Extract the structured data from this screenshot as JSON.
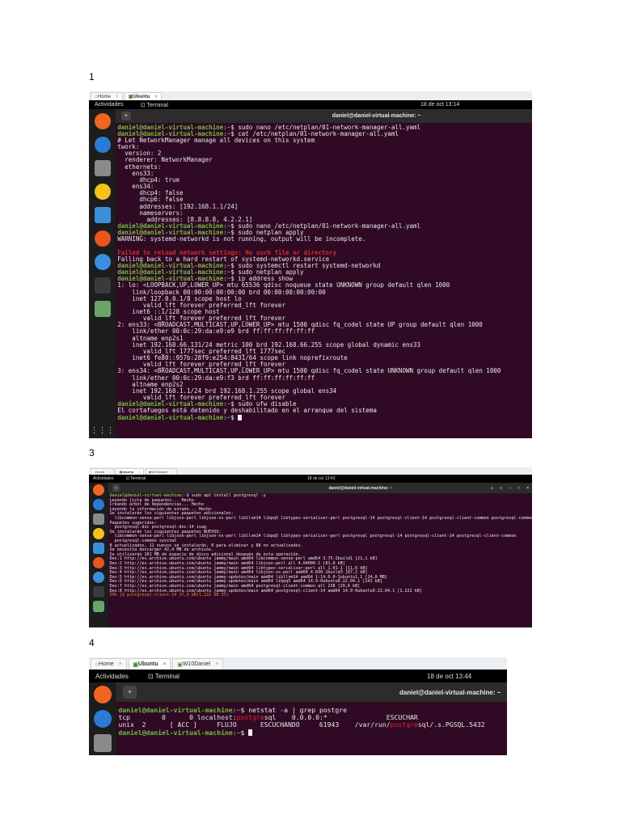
{
  "sections": [
    {
      "number": "1",
      "tabs": [
        {
          "label": "Home",
          "active": false
        },
        {
          "label": "Ubuntu",
          "active": true
        }
      ],
      "activities": "Actividades",
      "app": "Terminal",
      "clock": "18 de oct  13:14",
      "window_title": "daniel@daniel-virtual-machine: ~",
      "lines": [
        [
          [
            "prompt",
            "daniel@daniel-virtual-machine:"
          ],
          [
            "path",
            "~"
          ],
          [
            "",
            "$ sudo nano /etc/netplan/01-network-manager-all.yaml"
          ]
        ],
        [
          [
            "prompt",
            "daniel@daniel-virtual-machine:"
          ],
          [
            "path",
            "~"
          ],
          [
            "",
            "$ cat /etc/netplan/01-network-manager-all.yaml"
          ]
        ],
        [
          [
            "",
            "# Let NetworkManager manage all devices on this system"
          ]
        ],
        [
          [
            "",
            "twork:"
          ]
        ],
        [
          [
            "",
            "  version: 2"
          ]
        ],
        [
          [
            "",
            "  renderer: NetworkManager"
          ]
        ],
        [
          [
            "",
            "  ethernets:"
          ]
        ],
        [
          [
            "",
            "    ens33:"
          ]
        ],
        [
          [
            "",
            "      dhcp4: true"
          ]
        ],
        [
          [
            "",
            "    ens34:"
          ]
        ],
        [
          [
            "",
            "      dhcp4: false"
          ]
        ],
        [
          [
            "",
            "      dhcp6: false"
          ]
        ],
        [
          [
            "",
            "      addresses: [192.168.1.1/24]"
          ]
        ],
        [
          [
            "",
            "      nameservers:"
          ]
        ],
        [
          [
            "",
            "        addresses: [8.8.8.8, 4.2.2.1]"
          ]
        ],
        [
          [
            "prompt",
            "daniel@daniel-virtual-machine:"
          ],
          [
            "path",
            "~"
          ],
          [
            "",
            "$ sudo nano /etc/netplan/01-network-manager-all.yaml"
          ]
        ],
        [
          [
            "prompt",
            "daniel@daniel-virtual-machine:"
          ],
          [
            "path",
            "~"
          ],
          [
            "",
            "$ sudo netplan apply"
          ]
        ],
        [
          [
            "",
            "WARNING: systemd-networkd is not running, output will be incomplete."
          ]
        ],
        [
          [
            "",
            ""
          ]
        ],
        [
          [
            "err",
            "Failed to reload network settings: No such file or directory"
          ]
        ],
        [
          [
            "",
            "Falling back to a hard restart of systemd-networkd.service"
          ]
        ],
        [
          [
            "prompt",
            "daniel@daniel-virtual-machine:"
          ],
          [
            "path",
            "~"
          ],
          [
            "",
            "$ sudo systemctl restart systemd-networkd"
          ]
        ],
        [
          [
            "prompt",
            "daniel@daniel-virtual-machine:"
          ],
          [
            "path",
            "~"
          ],
          [
            "",
            "$ sudo netplan apply"
          ]
        ],
        [
          [
            "prompt",
            "daniel@daniel-virtual-machine:"
          ],
          [
            "path",
            "~"
          ],
          [
            "",
            "$ ip address show"
          ]
        ],
        [
          [
            "",
            "1: lo: <LOOPBACK,UP,LOWER_UP> mtu 65536 qdisc noqueue state UNKNOWN group default qlen 1000"
          ]
        ],
        [
          [
            "",
            "    link/loopback 00:00:00:00:00:00 brd 00:00:00:00:00:00"
          ]
        ],
        [
          [
            "",
            "    inet 127.0.0.1/8 scope host lo"
          ]
        ],
        [
          [
            "",
            "       valid_lft forever preferred_lft forever"
          ]
        ],
        [
          [
            "",
            "    inet6 ::1/128 scope host"
          ]
        ],
        [
          [
            "",
            "       valid_lft forever preferred_lft forever"
          ]
        ],
        [
          [
            "",
            "2: ens33: <BROADCAST,MULTICAST,UP,LOWER_UP> mtu 1500 qdisc fq_codel state UP group default qlen 1000"
          ]
        ],
        [
          [
            "",
            "    link/ether 00:0c:29:da:e9:e9 brd ff:ff:ff:ff:ff:ff"
          ]
        ],
        [
          [
            "",
            "    altname enp2s1"
          ]
        ],
        [
          [
            "",
            "    inet 192.168.66.131/24 metric 100 brd 192.168.66.255 scope global dynamic ens33"
          ]
        ],
        [
          [
            "",
            "       valid_lft 1777sec preferred_lft 1777sec"
          ]
        ],
        [
          [
            "",
            "    inet6 fe80::957b:28f9:e254:8431/64 scope link noprefixroute"
          ]
        ],
        [
          [
            "",
            "       valid_lft forever preferred_lft forever"
          ]
        ],
        [
          [
            "",
            "3: ens34: <BROADCAST,MULTICAST,UP,LOWER_UP> mtu 1500 qdisc fq_codel state UNKNOWN group default qlen 1000"
          ]
        ],
        [
          [
            "",
            "    link/ether 00:0c:29:da:e9:f3 brd ff:ff:ff:ff:ff:ff"
          ]
        ],
        [
          [
            "",
            "    altname enp2s2"
          ]
        ],
        [
          [
            "",
            "    inet 192.168.1.1/24 brd 192.168.1.255 scope global ens34"
          ]
        ],
        [
          [
            "",
            "       valid_lft forever preferred_lft forever"
          ]
        ],
        [
          [
            "prompt",
            "daniel@daniel-virtual-machine:"
          ],
          [
            "path",
            "~"
          ],
          [
            "",
            "$ sudo ufw disable"
          ]
        ],
        [
          [
            "",
            "El cortafuegos está detenido y deshabilitado en el arranque del sistema"
          ]
        ],
        [
          [
            "prompt",
            "daniel@daniel-virtual-machine:"
          ],
          [
            "path",
            "~"
          ],
          [
            "",
            "$ "
          ],
          [
            "cursor",
            " "
          ]
        ]
      ]
    },
    {
      "number": "3",
      "tabs": [
        {
          "label": "Home",
          "active": false
        },
        {
          "label": "Ubuntu",
          "active": true
        },
        {
          "label": "W10Daniel",
          "active": false
        }
      ],
      "activities": "Actividades",
      "app": "Terminal",
      "clock": "18 de oct  13:43",
      "window_title": "daniel@daniel-virtual-machine: ~",
      "lines": [
        [
          [
            "prompt",
            "daniel@daniel-virtual-machine:"
          ],
          [
            "path",
            "~"
          ],
          [
            "",
            "$ sudo apt install postgresql -y"
          ]
        ],
        [
          [
            "",
            "Leyendo lista de paquetes... Hecho"
          ]
        ],
        [
          [
            "",
            "Creando árbol de dependencias... Hecho"
          ]
        ],
        [
          [
            "",
            "Leyendo la información de estado... Hecho"
          ]
        ],
        [
          [
            "",
            "Se instalarán los siguientes paquetes adicionales:"
          ]
        ],
        [
          [
            "",
            "  libcommon-sense-perl libjson-perl libjson-xs-perl libllvm14 libpq5 libtypes-serialiser-perl postgresql-14 postgresql-client-14 postgresql-client-common postgresql-common sysstat"
          ]
        ],
        [
          [
            "",
            "Paquetes sugeridos:"
          ]
        ],
        [
          [
            "",
            "  postgresql-doc postgresql-doc-14 isag"
          ]
        ],
        [
          [
            "",
            "Se instalarán los siguientes paquetes NUEVOS:"
          ]
        ],
        [
          [
            "",
            "  libcommon-sense-perl libjson-perl libjson-xs-perl libllvm14 libpq5 libtypes-serialiser-perl postgresql postgresql-14 postgresql-client-14 postgresql-client-common"
          ]
        ],
        [
          [
            "",
            "  postgresql-common sysstat"
          ]
        ],
        [
          [
            "",
            "0 actualizados, 12 nuevos se instalarán, 0 para eliminar y 88 no actualizados."
          ]
        ],
        [
          [
            "",
            "Se necesita descargar 42,4 MB de archivos."
          ]
        ],
        [
          [
            "",
            "Se utilizarán 161 MB de espacio de disco adicional después de esta operación."
          ]
        ],
        [
          [
            "",
            "Des:1 http://es.archive.ubuntu.com/ubuntu jammy/main amd64 libcommon-sense-perl amd64 3.75-2build1 [21,1 kB]"
          ]
        ],
        [
          [
            "",
            "Des:2 http://es.archive.ubuntu.com/ubuntu jammy/main amd64 libjson-perl all 4.04000-1 [81,0 kB]"
          ]
        ],
        [
          [
            "",
            "Des:3 http://es.archive.ubuntu.com/ubuntu jammy/main amd64 libtypes-serialiser-perl all 1.01-1 [11,6 kB]"
          ]
        ],
        [
          [
            "",
            "Des:4 http://es.archive.ubuntu.com/ubuntu jammy/main amd64 libjson-xs-perl amd64 4.030-1build3 [87,2 kB]"
          ]
        ],
        [
          [
            "",
            "Des:5 http://es.archive.ubuntu.com/ubuntu jammy-updates/main amd64 libllvm14 amd64 1:14.0.0-1ubuntu1.1 [24,0 MB]"
          ]
        ],
        [
          [
            "",
            "Des:6 http://es.archive.ubuntu.com/ubuntu jammy-updates/main amd64 libpq5 amd64 14.9-0ubuntu0.22.04.1 [141 kB]"
          ]
        ],
        [
          [
            "",
            "Des:7 http://es.archive.ubuntu.com/ubuntu jammy/main amd64 postgresql-client-common all 238 [29,6 kB]"
          ]
        ],
        [
          [
            "",
            "Des:8 http://es.archive.ubuntu.com/ubuntu jammy-updates/main amd64 postgresql-client-14 amd64 14.9-0ubuntu0.22.04.1 [1.222 kB]"
          ]
        ],
        [
          [
            "dim",
            "59% [8 postgresql-client-14 37,0 kB/1.222 kB 3%]"
          ]
        ]
      ]
    },
    {
      "number": "4",
      "tabs": [
        {
          "label": "Home",
          "active": false
        },
        {
          "label": "Ubuntu",
          "active": true
        },
        {
          "label": "W10Daniel",
          "active": false
        }
      ],
      "activities": "Actividades",
      "app": "Terminal",
      "clock": "18 de oct  13:44",
      "window_title": "daniel@daniel-virtual-machine: ~",
      "lines": [
        [
          [
            "prompt",
            "daniel@daniel-virtual-machine:"
          ],
          [
            "path",
            "~"
          ],
          [
            "",
            "$ netstat -a | grep postgre"
          ]
        ],
        [
          [
            "",
            "tcp        0      0 localhost:"
          ],
          [
            "red",
            "postgre"
          ],
          [
            "",
            "sql    0.0.0.0:*               ESCUCHAR"
          ]
        ],
        [
          [
            "",
            "unix  2      [ ACC ]     FLUJO      ESCUCHANDO     61943    /var/run/"
          ],
          [
            "red",
            "postgre"
          ],
          [
            "",
            "sql/.s.PGSQL.5432"
          ]
        ],
        [
          [
            "prompt",
            "daniel@daniel-virtual-machine:"
          ],
          [
            "path",
            "~"
          ],
          [
            "",
            "$ "
          ],
          [
            "cursor",
            " "
          ]
        ]
      ]
    }
  ],
  "dock_icons": [
    "firefox-icon",
    "thunderbird-icon",
    "files-icon",
    "rhythmbox-icon",
    "libreoffice-writer-icon",
    "app-center-icon",
    "help-icon",
    "terminal-icon",
    "trash-icon"
  ],
  "colors": {
    "terminal_bg": "#300a24",
    "prompt": "#6ac13c",
    "path": "#5d8fd6",
    "highlight": "#e0262e"
  }
}
